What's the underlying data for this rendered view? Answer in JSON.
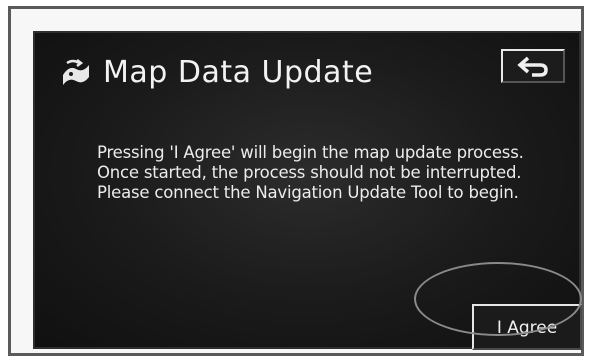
{
  "dialog": {
    "title": "Map Data Update",
    "title_icon": "map-update-icon",
    "back_icon": "return-arrow-icon",
    "message": "Pressing 'I Agree' will begin the map update process.  Once started, the process should not be interrupted. Please connect the Navigation Update Tool to begin.",
    "agree_label": "I Agree"
  },
  "colors": {
    "screen_background": "#1a1a1a",
    "text": "#f2f2f2",
    "frame_border": "#5a5a5a",
    "highlight_oval": "#8a8a8a"
  }
}
